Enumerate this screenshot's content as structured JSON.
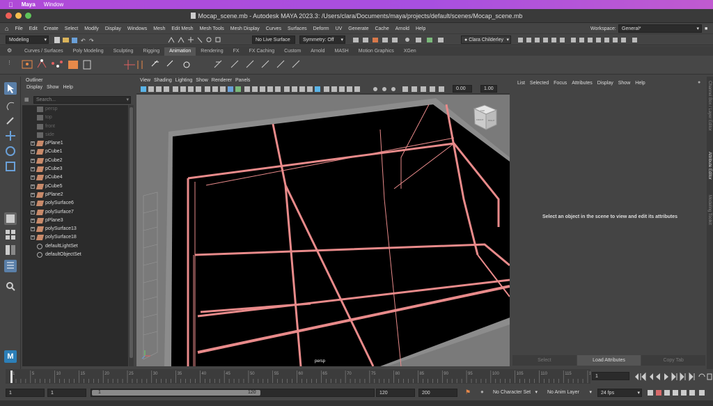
{
  "macmenu": {
    "app": "Maya",
    "window": "Window"
  },
  "title": "Mocap_scene.mb - Autodesk MAYA 2023.3: /Users/clara/Documents/maya/projects/default/scenes/Mocap_scene.mb",
  "menubar": [
    "File",
    "Edit",
    "Create",
    "Select",
    "Modify",
    "Display",
    "Windows",
    "Mesh",
    "Edit Mesh",
    "Mesh Tools",
    "Mesh Display",
    "Curves",
    "Surfaces",
    "Deform",
    "UV",
    "Generate",
    "Cache",
    "Arnold",
    "Help"
  ],
  "workspace": {
    "label": "Workspace:",
    "value": "General*"
  },
  "statusline": {
    "mode": "Modeling",
    "live_surface": "No Live Surface",
    "symmetry": "Symmetry: Off",
    "user": "Clara Childerley"
  },
  "shelf_tabs": [
    "Curves / Surfaces",
    "Poly Modeling",
    "Sculpting",
    "Rigging",
    "Animation",
    "Rendering",
    "FX",
    "FX Caching",
    "Custom",
    "Arnold",
    "MASH",
    "Motion Graphics",
    "XGen"
  ],
  "active_shelf": "Animation",
  "outliner": {
    "title": "Outliner",
    "menu": [
      "Display",
      "Show",
      "Help"
    ],
    "search_placeholder": "Search...",
    "items": [
      {
        "label": "persp",
        "dim": true,
        "expandable": false,
        "type": "camera"
      },
      {
        "label": "top",
        "dim": true,
        "expandable": false,
        "type": "camera"
      },
      {
        "label": "front",
        "dim": true,
        "expandable": false,
        "type": "camera"
      },
      {
        "label": "side",
        "dim": true,
        "expandable": false,
        "type": "camera"
      },
      {
        "label": "pPlane1",
        "dim": false,
        "expandable": true,
        "type": "mesh"
      },
      {
        "label": "pCube1",
        "dim": false,
        "expandable": true,
        "type": "mesh"
      },
      {
        "label": "pCube2",
        "dim": false,
        "expandable": true,
        "type": "mesh"
      },
      {
        "label": "pCube3",
        "dim": false,
        "expandable": true,
        "type": "mesh"
      },
      {
        "label": "pCube4",
        "dim": false,
        "expandable": true,
        "type": "mesh"
      },
      {
        "label": "pCube5",
        "dim": false,
        "expandable": true,
        "type": "mesh"
      },
      {
        "label": "pPlane2",
        "dim": false,
        "expandable": true,
        "type": "mesh"
      },
      {
        "label": "polySurface6",
        "dim": false,
        "expandable": true,
        "type": "mesh"
      },
      {
        "label": "polySurface7",
        "dim": false,
        "expandable": true,
        "type": "mesh"
      },
      {
        "label": "pPlane3",
        "dim": false,
        "expandable": true,
        "type": "mesh"
      },
      {
        "label": "polySurface13",
        "dim": false,
        "expandable": true,
        "type": "mesh"
      },
      {
        "label": "polySurface18",
        "dim": false,
        "expandable": true,
        "type": "mesh"
      },
      {
        "label": "defaultLightSet",
        "dim": false,
        "expandable": false,
        "type": "set"
      },
      {
        "label": "defaultObjectSet",
        "dim": false,
        "expandable": false,
        "type": "set"
      }
    ]
  },
  "viewport": {
    "menu": [
      "View",
      "Shading",
      "Lighting",
      "Show",
      "Renderer",
      "Panels"
    ],
    "camera_label": "persp",
    "exposure": "0.00",
    "gamma": "1.00",
    "viewcube": {
      "top": "TOP",
      "front": "FRONT",
      "right": "RIGHT"
    }
  },
  "attribute_editor": {
    "menu": [
      "List",
      "Selected",
      "Focus",
      "Attributes",
      "Display",
      "Show",
      "Help"
    ],
    "message": "Select an object in the scene to view and edit its attributes",
    "buttons": [
      "Select",
      "Load Attributes",
      "Copy Tab"
    ]
  },
  "side_tabs": [
    "Channel Box / Layer Editor",
    "Attribute Editor",
    "Modeling Toolkit"
  ],
  "timeline": {
    "ticks": [
      "1",
      "5",
      "10",
      "15",
      "20",
      "25",
      "30",
      "35",
      "40",
      "45",
      "50",
      "55",
      "60",
      "65",
      "70",
      "75",
      "80",
      "85",
      "90",
      "95",
      "100",
      "105",
      "110",
      "115",
      "120"
    ],
    "current_frame": "1"
  },
  "range": {
    "start": "1",
    "anim_start": "1",
    "slider_start": "1",
    "slider_end": "120",
    "anim_end": "120",
    "end": "200",
    "character_set": "No Character Set",
    "anim_layer": "No Anim Layer",
    "fps": "24 fps"
  },
  "colors": {
    "accent": "#5ab4e8",
    "wire": "#e88a8a",
    "maya_logo": "#2c7fb8"
  }
}
